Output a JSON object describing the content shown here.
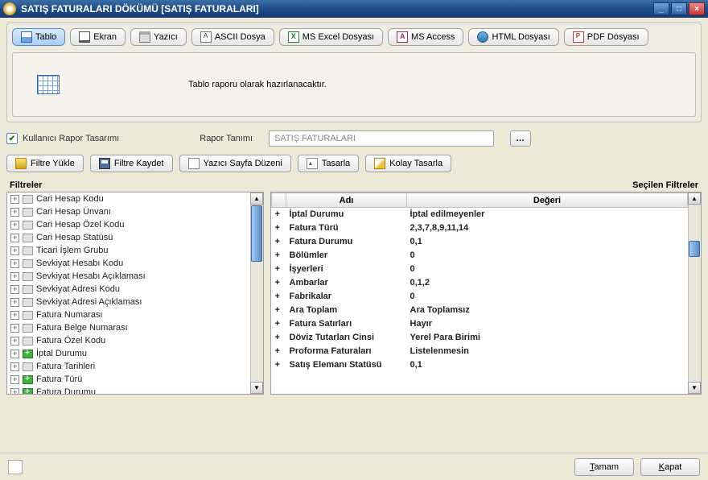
{
  "window": {
    "title": "SATIŞ FATURALARI DÖKÜMÜ [SATIŞ FATURALARI]"
  },
  "tabs": {
    "tablo": "Tablo",
    "ekran": "Ekran",
    "yazici": "Yazıcı",
    "ascii": "ASCII Dosya",
    "excel": "MS Excel Dosyası",
    "access": "MS Access",
    "html": "HTML Dosyası",
    "pdf": "PDF Dosyası"
  },
  "preview": {
    "text": "Tablo raporu olarak hazırlanacaktır."
  },
  "rapor": {
    "chk_label": "Kullanıcı Rapor Tasarımı",
    "tanim_label": "Rapor Tanımı",
    "tanim_value": "SATIŞ FATURALARI"
  },
  "actions": {
    "filtre_yukle": "Filtre Yükle",
    "filtre_kaydet": "Filtre Kaydet",
    "sayfa_duzeni": "Yazıcı Sayfa Düzeni",
    "tasarla": "Tasarla",
    "kolay_tasarla": "Kolay Tasarla"
  },
  "headers": {
    "filtreler": "Filtreler",
    "secilen": "Seçilen Filtreler",
    "adi": "Adı",
    "degeri": "Değeri"
  },
  "left_filters": [
    {
      "label": "Cari Hesap Kodu",
      "green": false
    },
    {
      "label": "Cari Hesap Ünvanı",
      "green": false
    },
    {
      "label": "Cari Hesap Özel Kodu",
      "green": false
    },
    {
      "label": "Cari Hesap Statüsü",
      "green": false
    },
    {
      "label": "Ticari İşlem Grubu",
      "green": false
    },
    {
      "label": "Sevkiyat Hesabı Kodu",
      "green": false
    },
    {
      "label": "Sevkiyat Hesabı Açıklaması",
      "green": false
    },
    {
      "label": "Sevkiyat Adresi Kodu",
      "green": false
    },
    {
      "label": "Sevkiyat Adresi Açıklaması",
      "green": false
    },
    {
      "label": "Fatura Numarası",
      "green": false
    },
    {
      "label": "Fatura Belge Numarası",
      "green": false
    },
    {
      "label": "Fatura Özel Kodu",
      "green": false
    },
    {
      "label": "İptal Durumu",
      "green": true
    },
    {
      "label": "Fatura Tarihleri",
      "green": false
    },
    {
      "label": "Fatura Türü",
      "green": true
    },
    {
      "label": "Fatura Durumu",
      "green": true
    }
  ],
  "selected_filters": [
    {
      "name": "İptal Durumu",
      "value": "İptal edilmeyenler"
    },
    {
      "name": "Fatura Türü",
      "value": "2,3,7,8,9,11,14"
    },
    {
      "name": "Fatura Durumu",
      "value": "0,1"
    },
    {
      "name": "Bölümler",
      "value": "0"
    },
    {
      "name": "İşyerleri",
      "value": "0"
    },
    {
      "name": "Ambarlar",
      "value": "0,1,2"
    },
    {
      "name": "Fabrikalar",
      "value": "0"
    },
    {
      "name": "Ara Toplam",
      "value": "Ara Toplamsız"
    },
    {
      "name": "Fatura Satırları",
      "value": "Hayır"
    },
    {
      "name": "Döviz Tutarları Cinsi",
      "value": "Yerel Para Birimi"
    },
    {
      "name": "Proforma Faturaları",
      "value": "Listelenmesin"
    },
    {
      "name": "Satış Elemanı Statüsü",
      "value": "0,1"
    }
  ],
  "footer": {
    "tamam": "Tamam",
    "kapat": "Kapat"
  }
}
